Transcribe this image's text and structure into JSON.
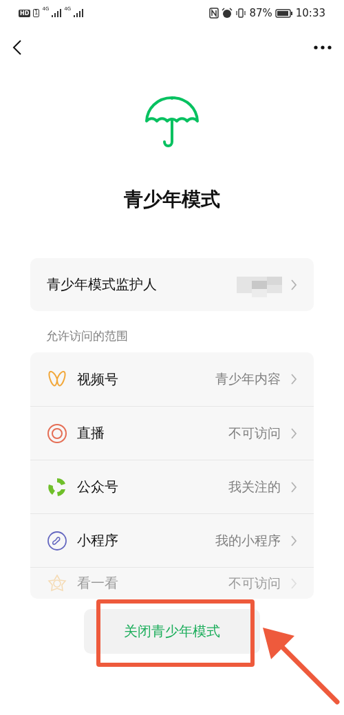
{
  "status_bar": {
    "left_labels": [
      "HD",
      "1",
      "4G",
      "4G"
    ],
    "battery": "87%",
    "time": "10:33"
  },
  "title": "青少年模式",
  "guardian": {
    "label": "青少年模式监护人",
    "redacted": true
  },
  "section_label": "允许访问的范围",
  "scope_items": [
    {
      "label": "视频号",
      "value": "青少年内容",
      "faded": false
    },
    {
      "label": "直播",
      "value": "不可访问",
      "faded": false
    },
    {
      "label": "公众号",
      "value": "我关注的",
      "faded": false
    },
    {
      "label": "小程序",
      "value": "我的小程序",
      "faded": false
    },
    {
      "label": "看一看",
      "value": "不可访问",
      "faded": true
    }
  ],
  "close_button": "关闭青少年模式",
  "highlight_box": true,
  "pointer_arrow": true
}
